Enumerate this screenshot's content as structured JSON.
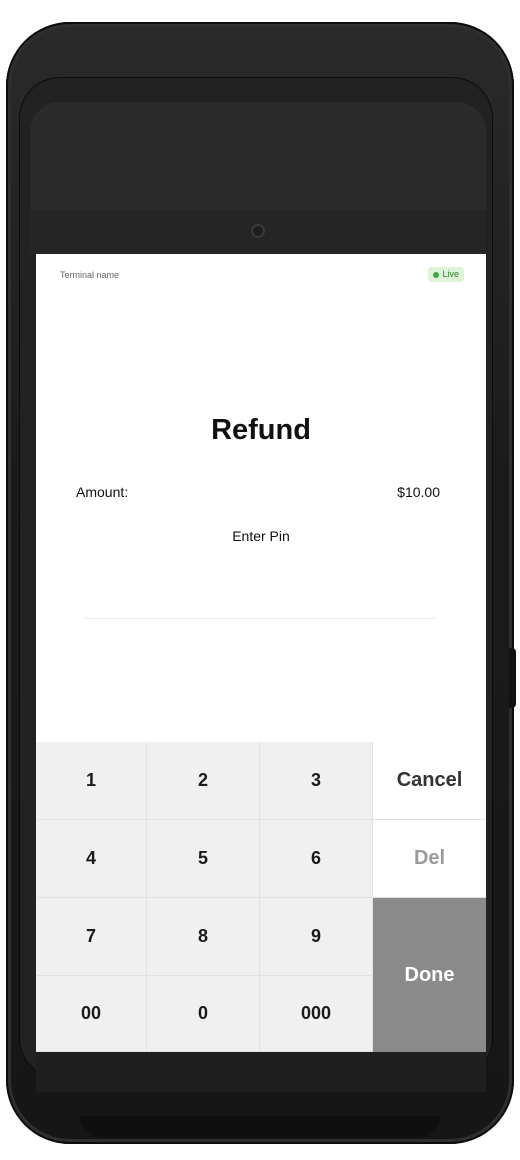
{
  "header": {
    "terminal_name": "Terminal name",
    "status": "Live",
    "status_color": "#3fa83f"
  },
  "transaction": {
    "title": "Refund",
    "amount_label": "Amount:",
    "amount_value": "$10.00",
    "pin_label": "Enter Pin",
    "pin_value": ""
  },
  "keypad": {
    "keys": [
      "1",
      "2",
      "3",
      "4",
      "5",
      "6",
      "7",
      "8",
      "9",
      "00",
      "0",
      "000"
    ],
    "cancel_label": "Cancel",
    "delete_label": "Del",
    "done_label": "Done",
    "done_color": "#8a8a8a"
  }
}
